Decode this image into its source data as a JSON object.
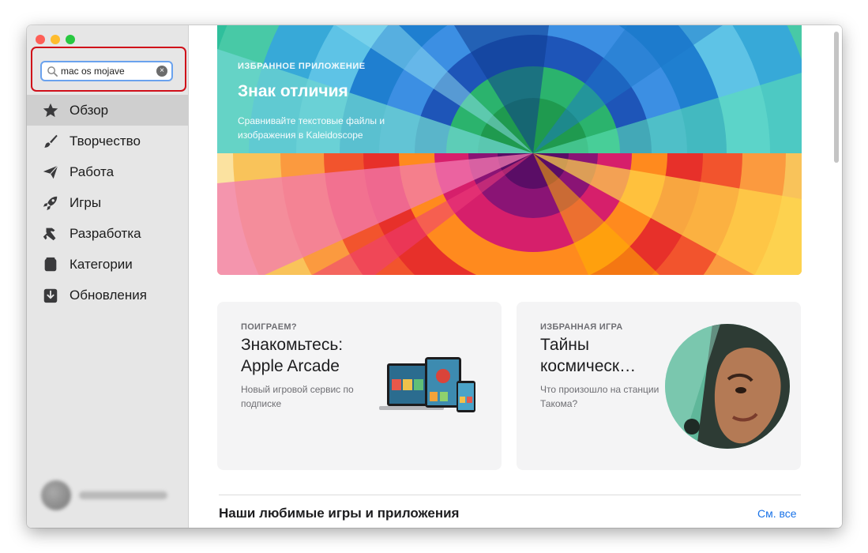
{
  "search": {
    "value": "mac os mojave",
    "clear_icon": "×"
  },
  "sidebar": {
    "items": [
      {
        "label": "Обзор",
        "icon": "star-icon",
        "active": true
      },
      {
        "label": "Творчество",
        "icon": "brush-icon"
      },
      {
        "label": "Работа",
        "icon": "paper-plane-icon"
      },
      {
        "label": "Игры",
        "icon": "rocket-icon"
      },
      {
        "label": "Разработка",
        "icon": "hammer-icon"
      },
      {
        "label": "Категории",
        "icon": "stack-icon"
      },
      {
        "label": "Обновления",
        "icon": "download-icon"
      }
    ]
  },
  "hero": {
    "eyebrow": "ИЗБРАННОЕ ПРИЛОЖЕНИЕ",
    "title": "Знак отличия",
    "subtitle": "Сравнивайте текстовые файлы и изображения в Kaleidoscope"
  },
  "cards": [
    {
      "eyebrow": "ПОИГРАЕМ?",
      "title": "Знакомьтесь: Apple Arcade",
      "subtitle": "Новый игровой сервис по подписке"
    },
    {
      "eyebrow": "ИЗБРАННАЯ ИГРА",
      "title": "Тайны космическ…",
      "subtitle": "Что произошло на станции Такома?"
    }
  ],
  "section": {
    "title": "Наши любимые игры и приложения",
    "see_all": "См. все"
  },
  "colors": {
    "accent": "#1a73e8",
    "highlight": "#d0101a",
    "sidebar_bg": "#e6e6e6"
  }
}
